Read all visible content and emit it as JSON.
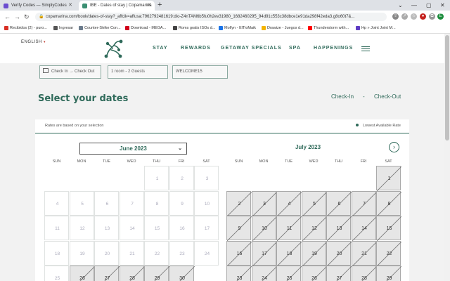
{
  "browser": {
    "tabs": [
      {
        "title": "Verify Codes — SimplyCodes",
        "fav_color": "#6a4ccf"
      },
      {
        "title": "IBE - Dates of stay | Copamarina",
        "fav_color": "#3b8f73"
      }
    ],
    "url": "copamarina.com/book/dates-of-stay?_affcik=affusa:7962792481619:dio-Z4nTAM6b5fu0h2ev31980_1682460295_94d91c553c38dbce1e91da298f42eda3.g8o60t7&...",
    "bookmarks": [
      {
        "label": "Recibidos (2) - puro...",
        "color": "#d93025"
      },
      {
        "label": "Ingresar",
        "color": "#555555"
      },
      {
        "label": "Counter-Strike Con...",
        "color": "#6b7b8c"
      },
      {
        "label": "Download - MEGA...",
        "color": "#d0021b"
      },
      {
        "label": "Roms gratis ISOs d...",
        "color": "#444444"
      },
      {
        "label": "Molfyn - ElTioMaik",
        "color": "#1a73e8"
      },
      {
        "label": "Drawize - Juegos d...",
        "color": "#f4b400"
      },
      {
        "label": "Thunderstorm with...",
        "color": "#ff0000"
      },
      {
        "label": "Hp » Joint Joint M...",
        "color": "#5f3dc4"
      }
    ]
  },
  "header": {
    "language": "ENGLISH",
    "nav": [
      "STAY",
      "REWARDS",
      "GETAWAY SPECIALS",
      "SPA",
      "HAPPENINGS"
    ]
  },
  "booking": {
    "dates": "Check In  →  Check Out",
    "rooms": "1 room - 2 Guests",
    "promo": "WELCOME15"
  },
  "calendar": {
    "title": "Select your dates",
    "check_in": "Check-In",
    "separator": "-",
    "check_out": "Check-Out",
    "rates_note": "Rates are based on your selection",
    "legend": "Lowest Available Rate",
    "month1": "June 2023",
    "month2": "July 2023",
    "dow": [
      "SUN",
      "MON",
      "TUE",
      "WED",
      "THU",
      "FRI",
      "SAT"
    ],
    "june_rows": [
      [
        "",
        "",
        "",
        "",
        "1",
        "2",
        "3"
      ],
      [
        "4",
        "5",
        "6",
        "7",
        "8",
        "9",
        "10"
      ],
      [
        "11",
        "12",
        "13",
        "14",
        "15",
        "16",
        "17"
      ],
      [
        "18",
        "19",
        "20",
        "21",
        "22",
        "23",
        "24"
      ],
      [
        "25",
        "26",
        "27",
        "28",
        "29",
        "30",
        ""
      ]
    ],
    "july_rows": [
      [
        "",
        "",
        "",
        "",
        "",
        "",
        "1"
      ],
      [
        "2",
        "3",
        "4",
        "5",
        "6",
        "7",
        "8"
      ],
      [
        "9",
        "10",
        "11",
        "12",
        "13",
        "14",
        "15"
      ],
      [
        "16",
        "17",
        "18",
        "19",
        "20",
        "21",
        "22"
      ],
      [
        "23",
        "24",
        "25",
        "26",
        "27",
        "28",
        "29"
      ]
    ],
    "june_disabled_from": 26,
    "july_disabled_from": 1
  },
  "colors": {
    "brand": "#2f6a5a"
  }
}
